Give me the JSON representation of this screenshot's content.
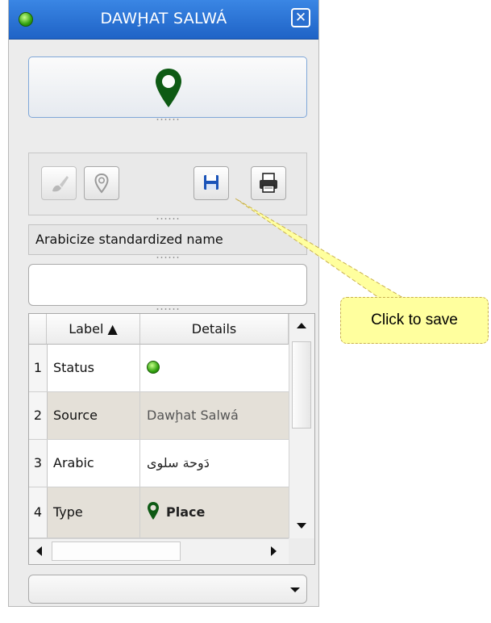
{
  "window": {
    "title": "DAWḨAT SALWÁ",
    "close_label": "✕"
  },
  "name_label": "Arabicize standardized name",
  "name_input": {
    "value": ""
  },
  "table": {
    "columns": [
      "Label ▲",
      "Details"
    ],
    "rows": [
      {
        "num": "1",
        "label": "Status",
        "details": "",
        "detail_icon": "green-status-dot-icon"
      },
      {
        "num": "2",
        "label": "Source",
        "details": "Dawḩat Salwá"
      },
      {
        "num": "3",
        "label": "Arabic",
        "details": "دَوحة سلوى"
      },
      {
        "num": "4",
        "label": "Type",
        "details": "Place",
        "detail_icon": "map-pin-icon"
      }
    ]
  },
  "dropdown": {
    "value": ""
  },
  "tooltip": {
    "text": "Click to save"
  },
  "icons": {
    "big_button": "map-pin-icon",
    "toolbar": [
      "brush-icon",
      "pin-outline-icon",
      "save-icon",
      "print-icon"
    ]
  },
  "colors": {
    "titlebar": "#2a6fd0",
    "pin": "#0e5a14",
    "tooltip_bg": "#ffff9e",
    "status_green": "#31a10f"
  }
}
